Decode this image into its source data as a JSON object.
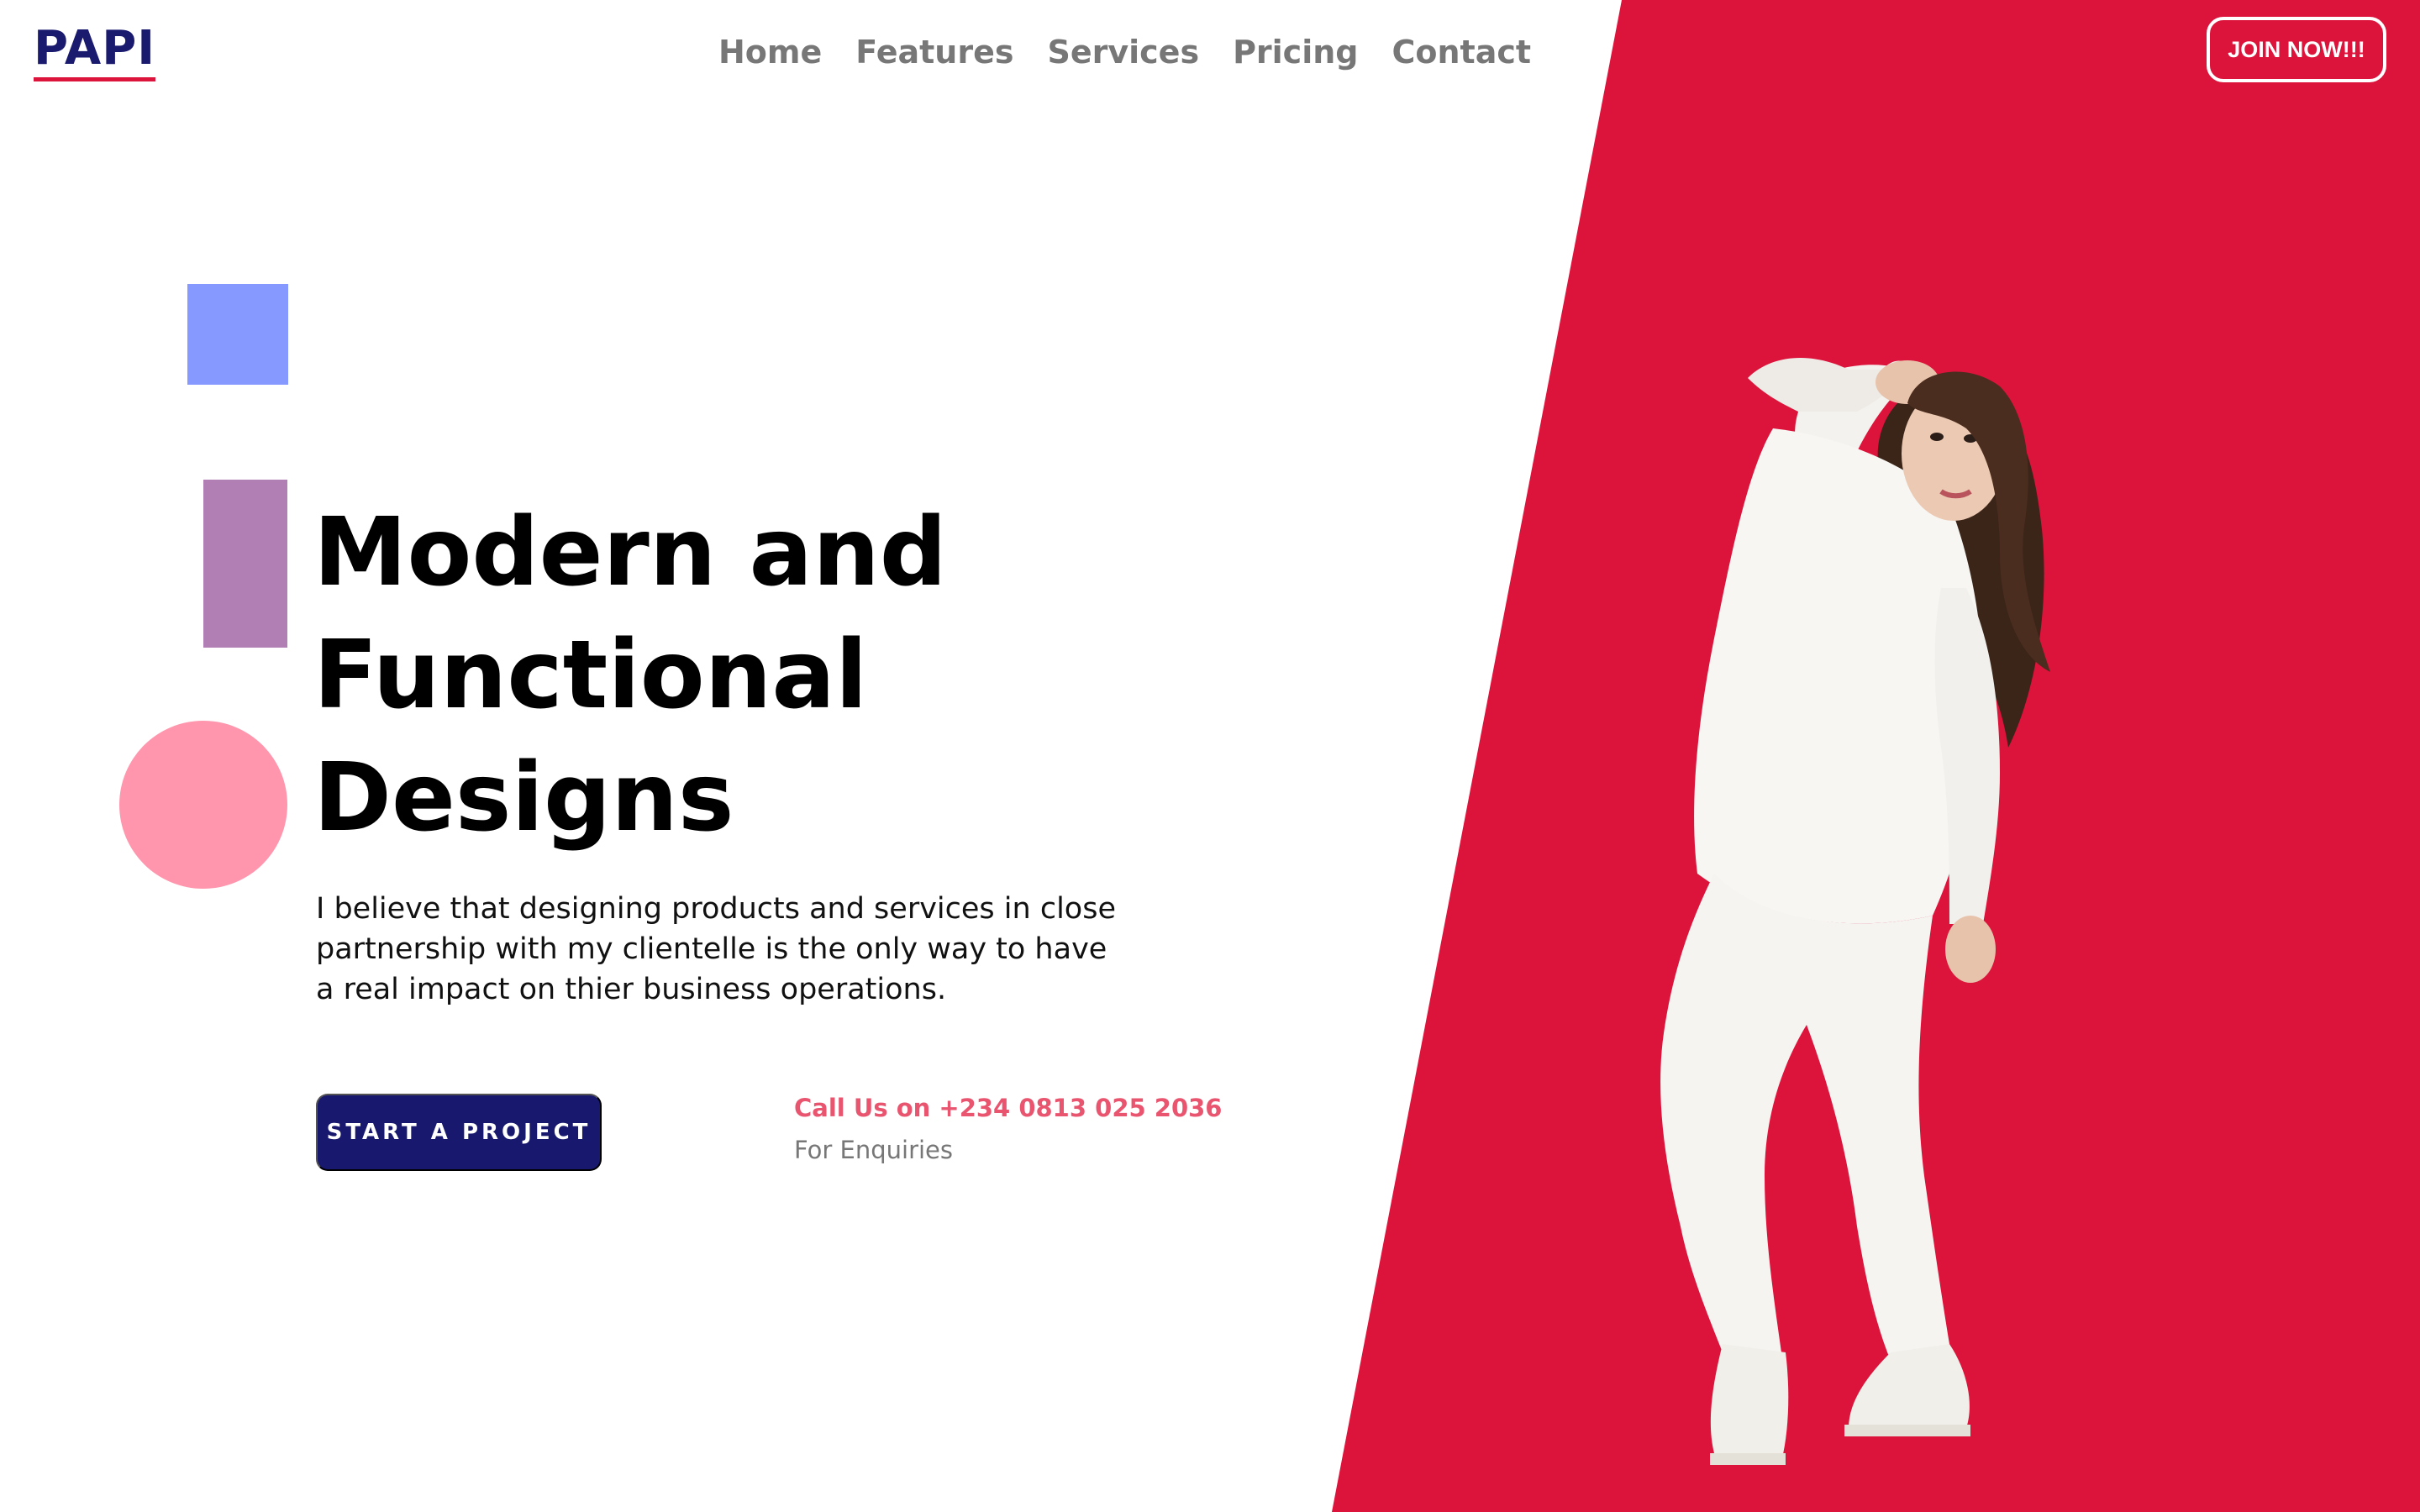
{
  "brand": {
    "logo": "PAPI"
  },
  "nav": {
    "items": [
      {
        "label": "Home"
      },
      {
        "label": "Features"
      },
      {
        "label": "Services"
      },
      {
        "label": "Pricing"
      },
      {
        "label": "Contact"
      }
    ]
  },
  "header": {
    "join_label": "JOIN NOW!!!"
  },
  "hero": {
    "title_lines": [
      "Modern and",
      "Functional",
      "Designs"
    ],
    "description": "I believe that designing products and services in close partnership with my clientelle is the only way to have a real impact on thier business operations.",
    "cta_label": "START A PROJECT",
    "call_text": "Call Us on +234 0813 025 2036",
    "enquiries_label": "For Enquiries"
  },
  "colors": {
    "brand_navy": "#1a1a6e",
    "accent_red": "#dc143c",
    "shape_blue": "#8599ff",
    "shape_purple": "#b17fb4",
    "shape_pink": "#ff96ad",
    "call_pink": "#e9546f"
  },
  "images": {
    "model_photo": "woman-in-white-outfit-jumping"
  }
}
